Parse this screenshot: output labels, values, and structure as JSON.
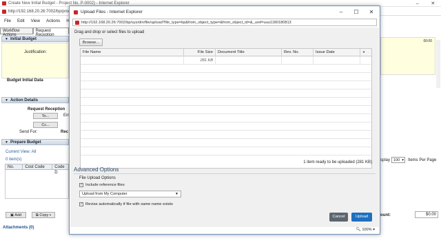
{
  "background": {
    "window_title": "Create New Initial Budget - Project No. P-0002) - Internet Explorer",
    "address": "http://192.168.20.26:7002/bp/proc",
    "menu": [
      "File",
      "Edit",
      "View",
      "Actions",
      "Help"
    ],
    "tabs": [
      "Workflow Actions",
      "Request Reception"
    ],
    "initial_budget": {
      "header": "Initial Budget",
      "justification_label": "Justification:",
      "budget_label": "Budget Initial Data"
    },
    "action_details": {
      "header": "Action Details",
      "request_reception": "Request Reception",
      "to_button": "To...",
      "cc_button": "Cc...",
      "send_for_label": "Send For:",
      "ent_abbr": "Ent",
      "rec_abbr": "Rec"
    },
    "prepare_budget": {
      "header": "Prepare Budget",
      "current_view_label": "Current View:",
      "current_view_value": "All",
      "items_count": "0 item(s)",
      "columns": [
        "No.",
        "Cost Code",
        "Code D"
      ],
      "add_button": "Add",
      "copy_button": "Copy"
    },
    "right_panel": {
      "display_label": "splay",
      "per_page_value": "100",
      "items_per_page": "Items Per Page",
      "amount_label": "ount:",
      "amount_value": "$0.00",
      "top_value": "00:00"
    },
    "attachments": "Attachments (0)"
  },
  "dialog": {
    "title": "Upload Files - Internet Explorer",
    "address": "http://192.168.20.26:7002/bp/sys/dm/file/upload?file_type=bp&from_object_type=&from_object_id=&_uref=uuu1180180813",
    "drag_label": "Drag and drop or select files to upload",
    "browse_label": "Browse...",
    "columns": [
      "File Name",
      "File Size",
      "Document Title",
      "Rev. No.",
      "Issue Date"
    ],
    "rows": [
      {
        "file_name": "",
        "file_size": "281 KB",
        "document_title": "",
        "rev_no": "",
        "issue_date": ""
      }
    ],
    "status": "1 item ready to be uploaded (281 KB)",
    "advanced_title": "Advanced Options",
    "file_upload_options_label": "File Upload Options",
    "include_reference_files": "Include reference files",
    "upload_source": "Upload from My Computer",
    "revise_automatically": "Revise automatically if file with same name exists",
    "cancel_label": "Cancel",
    "upload_label": "Upload",
    "zoom": "100%"
  }
}
